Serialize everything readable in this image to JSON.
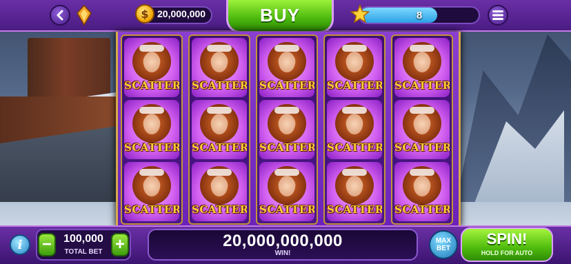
{
  "header": {
    "coins": "20,000,000",
    "buy_label": "BUY",
    "level": "8",
    "level_progress": 0.65
  },
  "reels": {
    "symbol_label": "SCATTER",
    "columns": 5,
    "rows": 3,
    "symbol": "scatter"
  },
  "footer": {
    "info_label": "i",
    "bet_minus": "−",
    "bet_plus": "+",
    "total_bet_value": "100,000",
    "total_bet_label": "TOTAL BET",
    "win_value": "20,000,000,000",
    "win_label": "WIN!",
    "max_bet_line1": "MAX",
    "max_bet_line2": "BET",
    "spin_label": "SPIN!",
    "spin_sub": "HOLD FOR AUTO"
  },
  "colors": {
    "accent": "#6a2fa6",
    "buy_green": "#4bb80d",
    "scatter_gold": "#ffcf3a"
  }
}
